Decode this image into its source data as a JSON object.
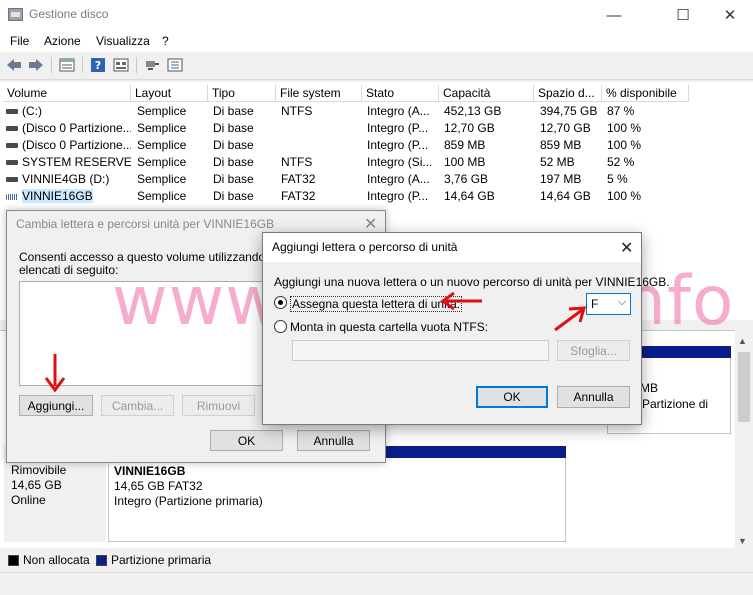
{
  "window": {
    "title": "Gestione disco",
    "minimize_glyph": "—",
    "maximize_glyph": "☐",
    "close_glyph": "✕"
  },
  "menu": [
    "File",
    "Azione",
    "Visualizza",
    "?"
  ],
  "toolbar": {
    "icons": [
      "back-arrow-icon",
      "forward-arrow-icon",
      "properties-icon",
      "help-icon",
      "list-view-icon",
      "connect-icon",
      "settings-list-icon"
    ]
  },
  "table": {
    "columns": [
      "Volume",
      "Layout",
      "Tipo",
      "File system",
      "Stato",
      "Capacità",
      "Spazio d...",
      "% disponibile"
    ],
    "rows": [
      {
        "volume": " (C:)",
        "layout": "Semplice",
        "tipo": "Di base",
        "fs": "NTFS",
        "stato": "Integro (A...",
        "capacita": "452,13 GB",
        "spazio": "394,75 GB",
        "perc": "87 %",
        "icon": "drive"
      },
      {
        "volume": "(Disco 0 Partizione...",
        "layout": "Semplice",
        "tipo": "Di base",
        "fs": "",
        "stato": "Integro (P...",
        "capacita": "12,70 GB",
        "spazio": "12,70 GB",
        "perc": "100 %",
        "icon": "drive"
      },
      {
        "volume": "(Disco 0 Partizione...",
        "layout": "Semplice",
        "tipo": "Di base",
        "fs": "",
        "stato": "Integro (P...",
        "capacita": "859 MB",
        "spazio": "859 MB",
        "perc": "100 %",
        "icon": "drive"
      },
      {
        "volume": "SYSTEM RESERVED",
        "layout": "Semplice",
        "tipo": "Di base",
        "fs": "NTFS",
        "stato": "Integro (Si...",
        "capacita": "100 MB",
        "spazio": "52 MB",
        "perc": "52 %",
        "icon": "drive"
      },
      {
        "volume": "VINNIE4GB (D:)",
        "layout": "Semplice",
        "tipo": "Di base",
        "fs": "FAT32",
        "stato": "Integro (A...",
        "capacita": "3,76 GB",
        "spazio": "197 MB",
        "perc": "5 %",
        "icon": "drive"
      },
      {
        "volume": "VINNIE16GB",
        "layout": "Semplice",
        "tipo": "Di base",
        "fs": "FAT32",
        "stato": "Integro (P...",
        "capacita": "14,64 GB",
        "spazio": "14,64 GB",
        "perc": "100 %",
        "icon": "usb",
        "selected": true
      }
    ]
  },
  "lower": {
    "right_partition": {
      "line1": "MB",
      "line2": "o (Partizione di"
    },
    "disk": {
      "type": "Rimovibile",
      "size": "14,65 GB",
      "status": "Online"
    },
    "partition": {
      "name": "VINNIE16GB",
      "size_fs": "14,65 GB FAT32",
      "status": "Integro (Partizione primaria)"
    }
  },
  "legend": {
    "items": [
      {
        "label": "Non allocata",
        "color": "#000000"
      },
      {
        "label": "Partizione primaria",
        "color": "#0a1e8a"
      }
    ]
  },
  "dialog1": {
    "title": "Cambia lettera e percorsi unità per VINNIE16GB",
    "text_line1": "Consenti accesso a questo volume utilizzando la lett",
    "text_line2": "elencati di seguito:",
    "buttons": {
      "add": "Aggiungi...",
      "change": "Cambia...",
      "remove": "Rimuovi",
      "ok": "OK",
      "cancel": "Annulla"
    }
  },
  "dialog2": {
    "title": "Aggiungi lettera o percorso di unità",
    "description": "Aggiungi una nuova lettera o un nuovo percorso di unità per VINNIE16GB.",
    "option_assign": "Assegna questa lettera di unità:",
    "option_mount": "Monta in questa cartella vuota NTFS:",
    "drive_letter": "F",
    "browse": "Sfoglia...",
    "ok": "OK",
    "cancel": "Annulla"
  },
  "watermark": "www.guidami.info",
  "colors": {
    "accent": "#0078d7",
    "primary_partition": "#0a1e8a",
    "watermark": "#f06aa5",
    "annotation_arrow": "#e01010"
  }
}
